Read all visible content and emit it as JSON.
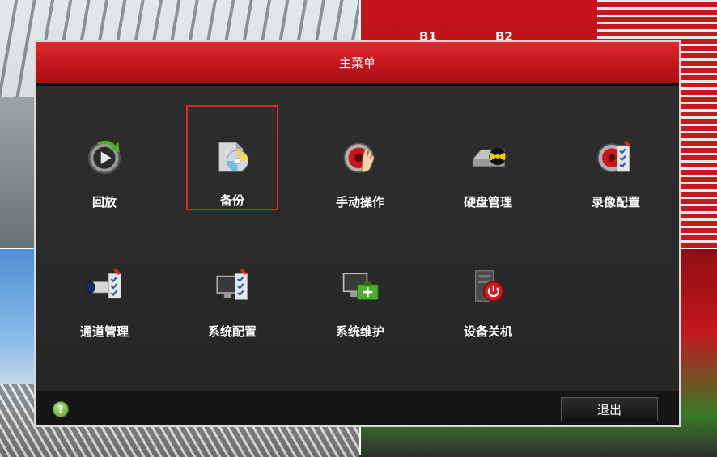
{
  "background": {
    "labels": [
      "B1",
      "B2"
    ]
  },
  "dialog": {
    "title": "主菜单",
    "items": [
      {
        "id": "playback",
        "label": "回放",
        "icon": "playback-icon"
      },
      {
        "id": "backup",
        "label": "备份",
        "icon": "backup-disc-icon",
        "selected": true
      },
      {
        "id": "manual",
        "label": "手动操作",
        "icon": "manual-record-icon"
      },
      {
        "id": "hdd",
        "label": "硬盘管理",
        "icon": "hdd-icon"
      },
      {
        "id": "record-config",
        "label": "录像配置",
        "icon": "record-config-icon"
      },
      {
        "id": "channel",
        "label": "通道管理",
        "icon": "camera-icon"
      },
      {
        "id": "system-config",
        "label": "系统配置",
        "icon": "system-config-icon"
      },
      {
        "id": "maintenance",
        "label": "系统维护",
        "icon": "maintenance-icon"
      },
      {
        "id": "shutdown",
        "label": "设备关机",
        "icon": "shutdown-icon"
      }
    ],
    "footer": {
      "help": "?",
      "exit_label": "退出"
    }
  },
  "colors": {
    "accent": "#c8161c",
    "selection": "#e0262b"
  }
}
